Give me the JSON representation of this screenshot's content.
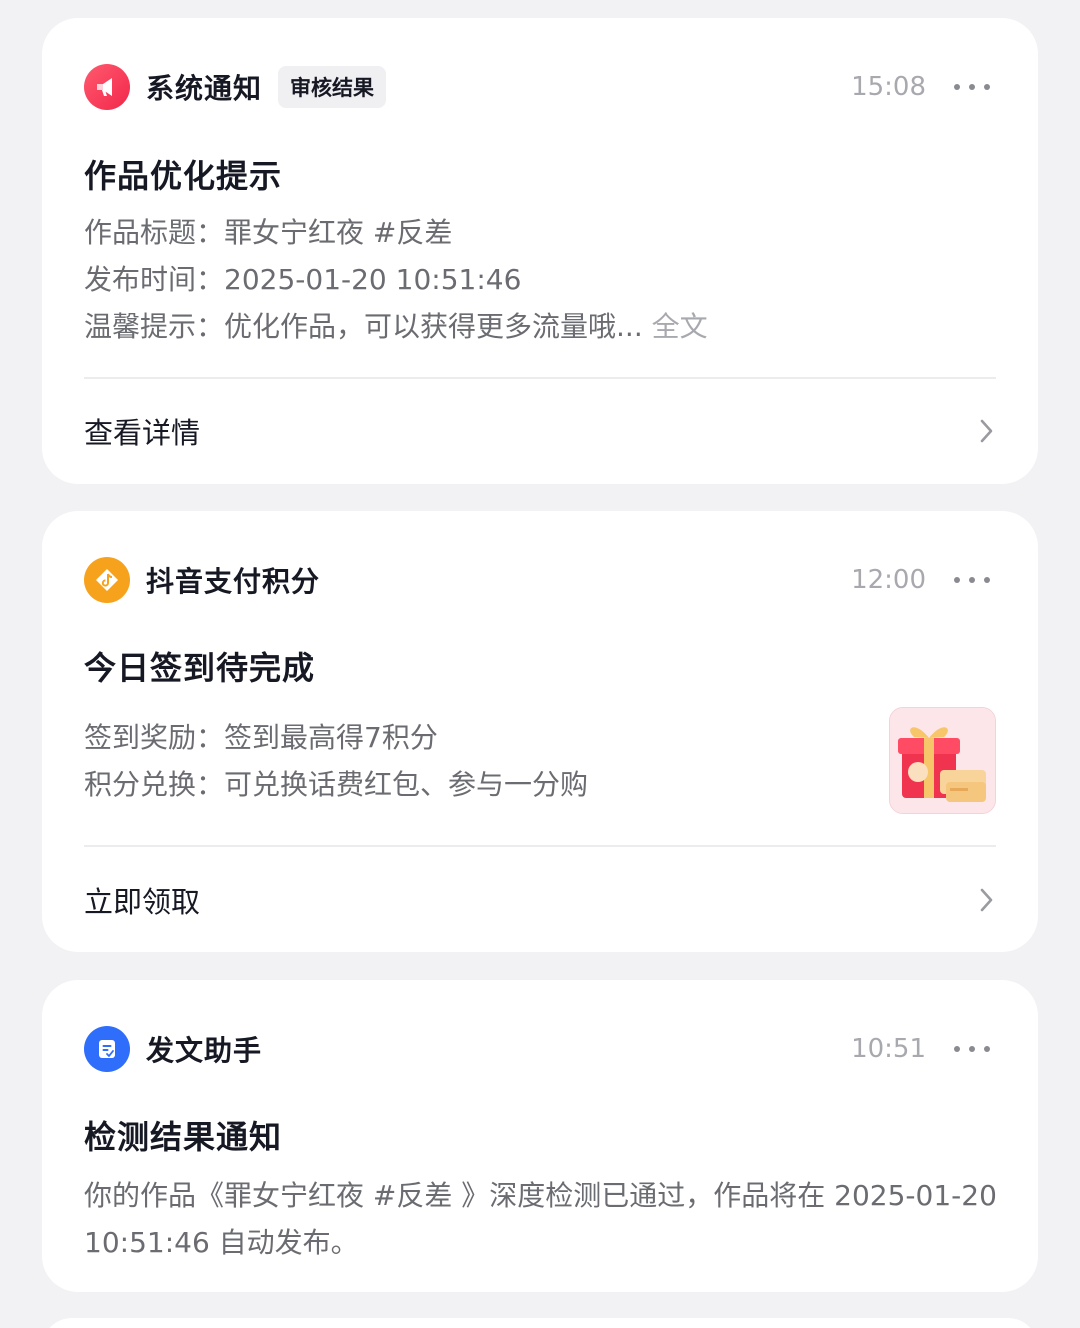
{
  "notifications": [
    {
      "sender": "系统通知",
      "tag": "审核结果",
      "time": "15:08",
      "title": "作品优化提示",
      "lines": [
        {
          "label": "作品标题：",
          "value": "罪女宁红夜 #反差"
        },
        {
          "label": "发布时间：",
          "value": "2025-01-20 10:51:46"
        },
        {
          "label": "温馨提示：",
          "value": "优化作品，可以获得更多流量哦...",
          "more": "全文"
        }
      ],
      "action": "查看详情"
    },
    {
      "sender": "抖音支付积分",
      "time": "12:00",
      "title": "今日签到待完成",
      "lines": [
        {
          "label": "签到奖励：",
          "value": "签到最高得7积分"
        },
        {
          "label": "积分兑换：",
          "value": "可兑换话费红包、参与一分购"
        }
      ],
      "action": "立即领取"
    },
    {
      "sender": "发文助手",
      "time": "10:51",
      "title": "检测结果通知",
      "body": "你的作品《罪女宁红夜 #反差 》深度检测已通过，作品将在 2025-01-20 10:51:46 自动发布。"
    }
  ],
  "icons": {
    "system": "megaphone-icon",
    "pay_points": "douyin-pay-icon",
    "post_assistant": "document-icon",
    "more": "more-dots-icon",
    "chevron": "chevron-right-icon"
  },
  "colors": {
    "background": "#f2f2f4",
    "card": "#ffffff",
    "system_icon": "#f2274b",
    "pay_icon": "#f7a21c",
    "assistant_icon": "#2f6dfb",
    "primary_text": "#161823",
    "secondary_text": "#6b6c71",
    "muted_text": "#a8a9ae"
  }
}
